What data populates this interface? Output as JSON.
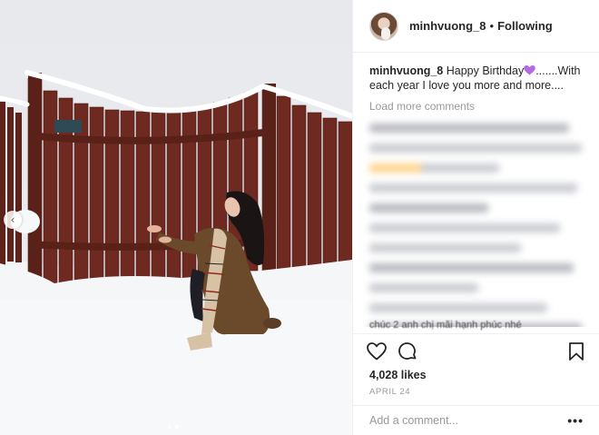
{
  "post": {
    "username": "minhvuong_8",
    "separator": "•",
    "follow_label": "Following"
  },
  "caption": {
    "username": "minhvuong_8",
    "text_before_emoji": " Happy Birthday",
    "text_after_emoji": ".......With each year I love you more and more...."
  },
  "comments": {
    "load_more_label": "Load more comments",
    "partial_visible_text": "chúc 2 anh chị mãi hạnh phúc nhé"
  },
  "actions": {
    "like_icon": "heart-outline-icon",
    "comment_icon": "comment-bubble-icon",
    "save_icon": "bookmark-icon"
  },
  "stats": {
    "likes": "4,028 likes",
    "date": "APRIL 24"
  },
  "comment_box": {
    "placeholder": "Add a comment...",
    "more_label": "•••"
  },
  "carousel": {
    "prev_icon": "chevron-left-icon",
    "slide_count": 2,
    "active_slide": 2
  },
  "colors": {
    "text": "#262626",
    "muted": "#999999",
    "border": "#efefef",
    "emoji_heart": "#b36ae2",
    "fence": "#6e2a20"
  }
}
